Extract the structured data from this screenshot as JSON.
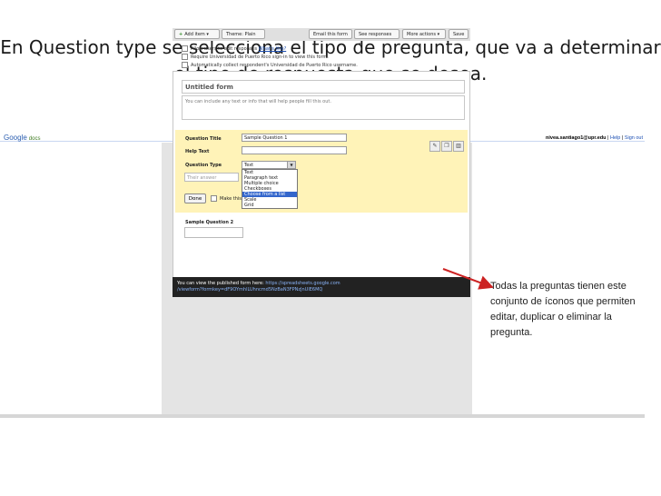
{
  "slide": {
    "title": "En Question type se selecciona el tipo de pregunta, que va a determinar el tipo de respuesta que se desea."
  },
  "gbar": {
    "logo": "Google",
    "logo_suffix": "docs",
    "user_email": "nivea.santiago1@upr.edu",
    "separator1": "|",
    "help": "Help",
    "separator2": "|",
    "sign_out": "Sign out"
  },
  "toolbar": {
    "add_item": "Add item",
    "add_item_icon": "plus-icon",
    "theme": "Theme: Plain",
    "email_form": "Email this form",
    "see_responses": "See responses",
    "more_actions": "More actions",
    "save": "Save"
  },
  "settings": {
    "allow_edit": "Allow users to edit responses",
    "whats_this": "What's this?",
    "require_signin": "Require Universidad de Puerto Rico sign-in to view this form.",
    "collect_username": "Automatically collect respondent's Universidad de Puerto Rico username."
  },
  "form": {
    "title": "Untitled form",
    "description": "You can include any text or info that will help people fill this out."
  },
  "question": {
    "title_label": "Question Title",
    "title_value": "Sample Question 1",
    "help_label": "Help Text",
    "type_label": "Question Type",
    "type_value": "Text",
    "answer_placeholder": "Their answer",
    "done": "Done",
    "make_required": "Make this a required question",
    "type_options": [
      "Text",
      "Paragraph text",
      "Multiple choice",
      "Checkboxes",
      "Choose from a list",
      "Scale",
      "Grid"
    ],
    "highlighted_option": 4,
    "icons": [
      "pencil-icon",
      "copy-icon",
      "trash-icon"
    ]
  },
  "question2": {
    "title": "Sample Question 2"
  },
  "footer": {
    "text": "You can view the published form here:",
    "url_line1": "https://spreadsheets.google.com",
    "url_line2": "/viewform?formkey=dF9OYmhlLUhncmd5NzBaN3FPNzJnUlE6MQ"
  },
  "annotation": {
    "text": "Todas la preguntas tienen este conjunto de íconos que permiten editar, duplicar o eliminar la pregunta."
  },
  "colors": {
    "arrow": "#cc2222",
    "yellow_panel": "#fff3b8",
    "selected_option": "#3366cc"
  }
}
